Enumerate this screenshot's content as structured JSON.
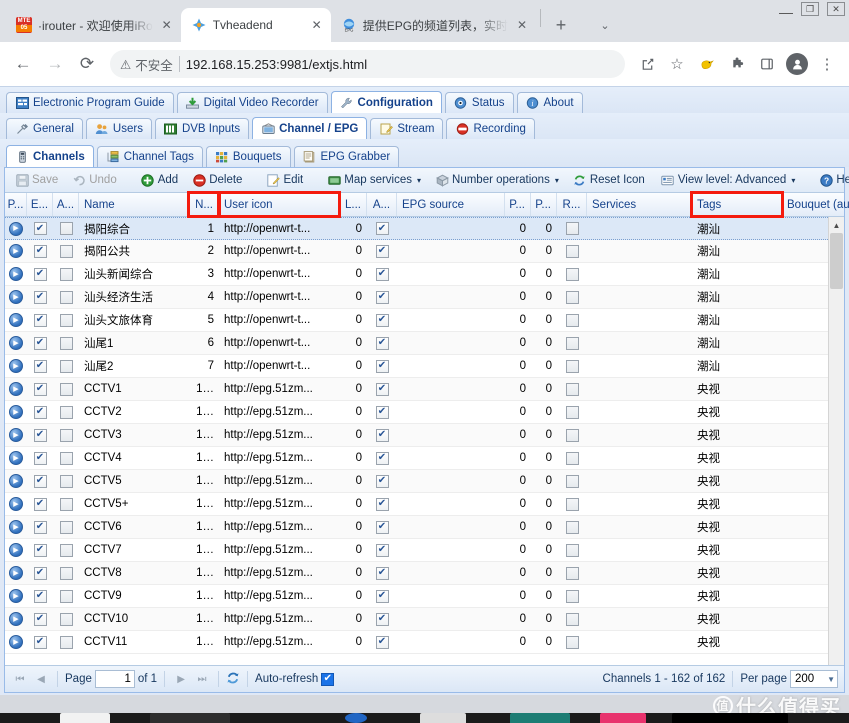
{
  "browser": {
    "tabs": [
      {
        "title": "·irouter - 欢迎使用iRo",
        "favicon": "mte-icon",
        "active": false
      },
      {
        "title": "Tvheadend",
        "favicon": "tvheadend-icon",
        "active": true
      },
      {
        "title": "提供EPG的频道列表，实时",
        "favicon": "epg-icon",
        "active": false
      }
    ],
    "new_tab_label": "+",
    "tab_list_label": "⌄",
    "window_controls": {
      "minimize": "—",
      "maximize": "❐",
      "close": "✕"
    },
    "nav": {
      "back": "←",
      "forward": "→",
      "reload": "⟳"
    },
    "omnibox": {
      "security_label": "不安全",
      "security_icon": "warning-triangle-icon",
      "url": "192.168.15.253:9981/extjs.html"
    },
    "actions": {
      "share": "share-icon",
      "bookmark": "star-icon",
      "extension_bird": "bird-extension-icon",
      "extensions": "puzzle-icon",
      "sidepanel": "side-panel-icon",
      "profile": "profile-avatar-icon",
      "menu": "three-dot-menu-icon"
    }
  },
  "tvheadend": {
    "main_tabs": [
      {
        "label": "Electronic Program Guide",
        "icon": "epg-grid-icon",
        "active": false
      },
      {
        "label": "Digital Video Recorder",
        "icon": "dvr-download-icon",
        "active": false
      },
      {
        "label": "Configuration",
        "icon": "wrench-icon",
        "active": true
      },
      {
        "label": "Status",
        "icon": "eye-icon",
        "active": false
      },
      {
        "label": "About",
        "icon": "info-icon",
        "active": false
      }
    ],
    "sub_tabs": [
      {
        "label": "General",
        "icon": "tools-icon",
        "active": false
      },
      {
        "label": "Users",
        "icon": "users-icon",
        "active": false
      },
      {
        "label": "DVB Inputs",
        "icon": "dvb-card-icon",
        "active": false
      },
      {
        "label": "Channel / EPG",
        "icon": "tv-icon",
        "active": true
      },
      {
        "label": "Stream",
        "icon": "stream-icon",
        "active": false
      },
      {
        "label": "Recording",
        "icon": "record-icon",
        "active": false
      }
    ],
    "sub_sub_tabs": [
      {
        "label": "Channels",
        "icon": "remote-control-icon",
        "active": true
      },
      {
        "label": "Channel Tags",
        "icon": "tags-tree-icon",
        "active": false
      },
      {
        "label": "Bouquets",
        "icon": "grid-squares-icon",
        "active": false
      },
      {
        "label": "EPG Grabber",
        "icon": "epg-grabber-icon",
        "active": false
      }
    ],
    "toolbar": {
      "save": {
        "label": "Save",
        "icon": "save-disk-icon",
        "disabled": true
      },
      "undo": {
        "label": "Undo",
        "icon": "undo-arrow-icon",
        "disabled": true
      },
      "add": {
        "label": "Add",
        "icon": "add-plus-icon",
        "disabled": false
      },
      "delete": {
        "label": "Delete",
        "icon": "delete-minus-icon",
        "disabled": false
      },
      "edit": {
        "label": "Edit",
        "icon": "edit-pencil-icon",
        "disabled": false
      },
      "map_services": {
        "label": "Map services",
        "icon": "map-services-icon",
        "caret": "▾"
      },
      "number_operations": {
        "label": "Number operations",
        "icon": "number-ops-icon",
        "caret": "▾"
      },
      "reset_icon": {
        "label": "Reset Icon",
        "icon": "reset-refresh-icon"
      },
      "view_level": {
        "label": "View level: Advanced",
        "icon": "view-level-icon",
        "caret": "▾"
      },
      "help": {
        "label": "Help",
        "icon": "help-question-icon"
      }
    },
    "grid": {
      "columns": [
        {
          "key": "play",
          "label": "P...",
          "width": 22,
          "align": "center",
          "highlight": false
        },
        {
          "key": "enabled",
          "label": "E...",
          "width": 26,
          "align": "center",
          "highlight": false
        },
        {
          "key": "auto",
          "label": "A...",
          "width": 26,
          "align": "center",
          "highlight": false
        },
        {
          "key": "name",
          "label": "Name",
          "width": 110,
          "align": "left",
          "highlight": false
        },
        {
          "key": "number",
          "label": "N...",
          "width": 30,
          "align": "right",
          "highlight": true
        },
        {
          "key": "user_icon",
          "label": "User icon",
          "width": 120,
          "align": "left",
          "highlight": true
        },
        {
          "key": "l",
          "label": "L...",
          "width": 28,
          "align": "right",
          "highlight": false
        },
        {
          "key": "a2",
          "label": "A...",
          "width": 30,
          "align": "center",
          "highlight": false
        },
        {
          "key": "epg_source",
          "label": "EPG source",
          "width": 108,
          "align": "left",
          "highlight": false
        },
        {
          "key": "p1",
          "label": "P...",
          "width": 26,
          "align": "right",
          "highlight": false
        },
        {
          "key": "p2",
          "label": "P...",
          "width": 26,
          "align": "right",
          "highlight": false
        },
        {
          "key": "r",
          "label": "R...",
          "width": 30,
          "align": "center",
          "highlight": false
        },
        {
          "key": "services",
          "label": "Services",
          "width": 105,
          "align": "left",
          "highlight": false
        },
        {
          "key": "tags",
          "label": "Tags",
          "width": 90,
          "align": "left",
          "highlight": true
        },
        {
          "key": "bouquet",
          "label": "Bouquet (auto)",
          "width": 108,
          "align": "left",
          "highlight": false
        }
      ],
      "rows": [
        {
          "play": "play-icon",
          "enabled": true,
          "auto": false,
          "name": "揭阳综合",
          "number": "1",
          "user_icon": "http://openwrt-t...",
          "l": "0",
          "a2": true,
          "epg_source": "",
          "p1": "0",
          "p2": "0",
          "r": false,
          "services": "",
          "tags": "潮汕",
          "bouquet": "",
          "selected": true
        },
        {
          "play": "play-icon",
          "enabled": true,
          "auto": false,
          "name": "揭阳公共",
          "number": "2",
          "user_icon": "http://openwrt-t...",
          "l": "0",
          "a2": true,
          "epg_source": "",
          "p1": "0",
          "p2": "0",
          "r": false,
          "services": "",
          "tags": "潮汕",
          "bouquet": "",
          "selected": false
        },
        {
          "play": "play-icon",
          "enabled": true,
          "auto": false,
          "name": "汕头新闻综合",
          "number": "3",
          "user_icon": "http://openwrt-t...",
          "l": "0",
          "a2": true,
          "epg_source": "",
          "p1": "0",
          "p2": "0",
          "r": false,
          "services": "",
          "tags": "潮汕",
          "bouquet": "",
          "selected": false
        },
        {
          "play": "play-icon",
          "enabled": true,
          "auto": false,
          "name": "汕头经济生活",
          "number": "4",
          "user_icon": "http://openwrt-t...",
          "l": "0",
          "a2": true,
          "epg_source": "",
          "p1": "0",
          "p2": "0",
          "r": false,
          "services": "",
          "tags": "潮汕",
          "bouquet": "",
          "selected": false
        },
        {
          "play": "play-icon",
          "enabled": true,
          "auto": false,
          "name": "汕头文旅体育",
          "number": "5",
          "user_icon": "http://openwrt-t...",
          "l": "0",
          "a2": true,
          "epg_source": "",
          "p1": "0",
          "p2": "0",
          "r": false,
          "services": "",
          "tags": "潮汕",
          "bouquet": "",
          "selected": false
        },
        {
          "play": "play-icon",
          "enabled": true,
          "auto": false,
          "name": "汕尾1",
          "number": "6",
          "user_icon": "http://openwrt-t...",
          "l": "0",
          "a2": true,
          "epg_source": "",
          "p1": "0",
          "p2": "0",
          "r": false,
          "services": "",
          "tags": "潮汕",
          "bouquet": "",
          "selected": false
        },
        {
          "play": "play-icon",
          "enabled": true,
          "auto": false,
          "name": "汕尾2",
          "number": "7",
          "user_icon": "http://openwrt-t...",
          "l": "0",
          "a2": true,
          "epg_source": "",
          "p1": "0",
          "p2": "0",
          "r": false,
          "services": "",
          "tags": "潮汕",
          "bouquet": "",
          "selected": false
        },
        {
          "play": "play-icon",
          "enabled": true,
          "auto": false,
          "name": "CCTV1",
          "number": "1…",
          "user_icon": "http://epg.51zm...",
          "l": "0",
          "a2": true,
          "epg_source": "",
          "p1": "0",
          "p2": "0",
          "r": false,
          "services": "",
          "tags": "央视",
          "bouquet": "",
          "selected": false
        },
        {
          "play": "play-icon",
          "enabled": true,
          "auto": false,
          "name": "CCTV2",
          "number": "1…",
          "user_icon": "http://epg.51zm...",
          "l": "0",
          "a2": true,
          "epg_source": "",
          "p1": "0",
          "p2": "0",
          "r": false,
          "services": "",
          "tags": "央视",
          "bouquet": "",
          "selected": false
        },
        {
          "play": "play-icon",
          "enabled": true,
          "auto": false,
          "name": "CCTV3",
          "number": "1…",
          "user_icon": "http://epg.51zm...",
          "l": "0",
          "a2": true,
          "epg_source": "",
          "p1": "0",
          "p2": "0",
          "r": false,
          "services": "",
          "tags": "央视",
          "bouquet": "",
          "selected": false
        },
        {
          "play": "play-icon",
          "enabled": true,
          "auto": false,
          "name": "CCTV4",
          "number": "1…",
          "user_icon": "http://epg.51zm...",
          "l": "0",
          "a2": true,
          "epg_source": "",
          "p1": "0",
          "p2": "0",
          "r": false,
          "services": "",
          "tags": "央视",
          "bouquet": "",
          "selected": false
        },
        {
          "play": "play-icon",
          "enabled": true,
          "auto": false,
          "name": "CCTV5",
          "number": "1…",
          "user_icon": "http://epg.51zm...",
          "l": "0",
          "a2": true,
          "epg_source": "",
          "p1": "0",
          "p2": "0",
          "r": false,
          "services": "",
          "tags": "央视",
          "bouquet": "",
          "selected": false
        },
        {
          "play": "play-icon",
          "enabled": true,
          "auto": false,
          "name": "CCTV5+",
          "number": "1…",
          "user_icon": "http://epg.51zm...",
          "l": "0",
          "a2": true,
          "epg_source": "",
          "p1": "0",
          "p2": "0",
          "r": false,
          "services": "",
          "tags": "央视",
          "bouquet": "",
          "selected": false
        },
        {
          "play": "play-icon",
          "enabled": true,
          "auto": false,
          "name": "CCTV6",
          "number": "1…",
          "user_icon": "http://epg.51zm...",
          "l": "0",
          "a2": true,
          "epg_source": "",
          "p1": "0",
          "p2": "0",
          "r": false,
          "services": "",
          "tags": "央视",
          "bouquet": "",
          "selected": false
        },
        {
          "play": "play-icon",
          "enabled": true,
          "auto": false,
          "name": "CCTV7",
          "number": "1…",
          "user_icon": "http://epg.51zm...",
          "l": "0",
          "a2": true,
          "epg_source": "",
          "p1": "0",
          "p2": "0",
          "r": false,
          "services": "",
          "tags": "央视",
          "bouquet": "",
          "selected": false
        },
        {
          "play": "play-icon",
          "enabled": true,
          "auto": false,
          "name": "CCTV8",
          "number": "1…",
          "user_icon": "http://epg.51zm...",
          "l": "0",
          "a2": true,
          "epg_source": "",
          "p1": "0",
          "p2": "0",
          "r": false,
          "services": "",
          "tags": "央视",
          "bouquet": "",
          "selected": false
        },
        {
          "play": "play-icon",
          "enabled": true,
          "auto": false,
          "name": "CCTV9",
          "number": "1…",
          "user_icon": "http://epg.51zm...",
          "l": "0",
          "a2": true,
          "epg_source": "",
          "p1": "0",
          "p2": "0",
          "r": false,
          "services": "",
          "tags": "央视",
          "bouquet": "",
          "selected": false
        },
        {
          "play": "play-icon",
          "enabled": true,
          "auto": false,
          "name": "CCTV10",
          "number": "1…",
          "user_icon": "http://epg.51zm...",
          "l": "0",
          "a2": true,
          "epg_source": "",
          "p1": "0",
          "p2": "0",
          "r": false,
          "services": "",
          "tags": "央视",
          "bouquet": "",
          "selected": false
        },
        {
          "play": "play-icon",
          "enabled": true,
          "auto": false,
          "name": "CCTV11",
          "number": "1…",
          "user_icon": "http://epg.51zm...",
          "l": "0",
          "a2": true,
          "epg_source": "",
          "p1": "0",
          "p2": "0",
          "r": false,
          "services": "",
          "tags": "央视",
          "bouquet": "",
          "selected": false
        }
      ]
    },
    "paging": {
      "first": "⏮",
      "prev": "◀",
      "next": "▶",
      "last": "⏭",
      "page_label": "Page",
      "page_value": "1",
      "of_label": "of 1",
      "refresh_icon": "refresh-icon",
      "auto_refresh_label": "Auto-refresh",
      "auto_refresh_checked": true,
      "range_label": "Channels 1 - 162 of 162",
      "per_page_label": "Per page",
      "per_page_value": "200"
    },
    "scrollbar": {
      "up": "▲",
      "down": "▼"
    }
  },
  "watermark": {
    "mark": "值",
    "text": "什么值得买"
  },
  "colors": {
    "accent": "#15428b",
    "highlight_red": "#f41b0e",
    "panel_border": "#99bbe8",
    "selected_row": "#dce8f7"
  }
}
